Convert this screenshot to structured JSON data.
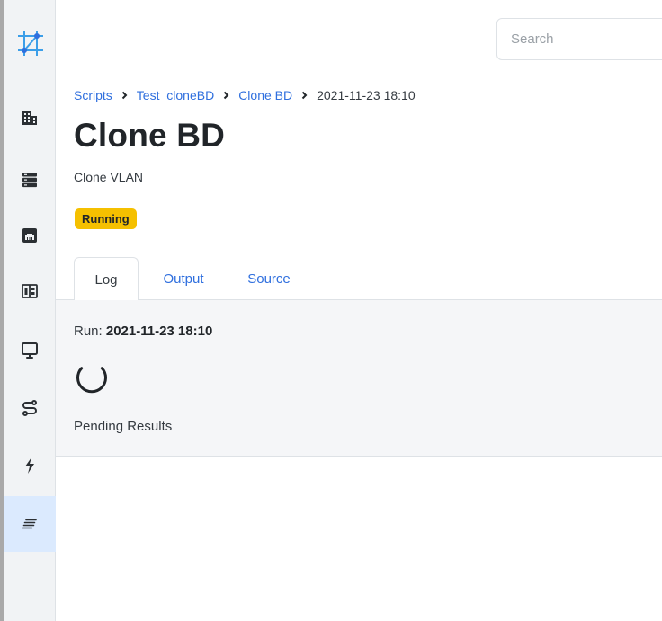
{
  "search": {
    "placeholder": "Search"
  },
  "breadcrumb": {
    "items": [
      {
        "label": "Scripts"
      },
      {
        "label": "Test_cloneBD"
      },
      {
        "label": "Clone BD"
      }
    ],
    "current": "2021-11-23 18:10"
  },
  "page": {
    "title": "Clone BD",
    "subtitle": "Clone VLAN",
    "status": "Running"
  },
  "tabs": [
    {
      "label": "Log",
      "active": true
    },
    {
      "label": "Output",
      "active": false
    },
    {
      "label": "Source",
      "active": false
    }
  ],
  "log": {
    "run_label": "Run:",
    "run_value": "2021-11-23 18:10",
    "pending_text": "Pending Results"
  },
  "sidebar": {
    "logo_icon": "network-logo-icon",
    "items": [
      {
        "icon": "building-icon"
      },
      {
        "icon": "server-rack-icon"
      },
      {
        "icon": "network-port-icon"
      },
      {
        "icon": "circuit-board-icon"
      },
      {
        "icon": "monitor-icon"
      },
      {
        "icon": "workflow-icon"
      },
      {
        "icon": "lightning-icon"
      },
      {
        "icon": "script-lines-icon",
        "active": true
      }
    ]
  },
  "colors": {
    "accent": "#2f6fde",
    "badge": "#f5c000",
    "active_nav": "#dbeafe",
    "logo": "#3b9ee8"
  }
}
